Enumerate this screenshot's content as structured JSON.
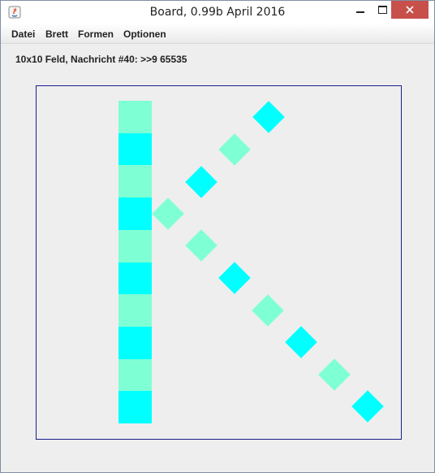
{
  "window": {
    "title": "Board, 0.99b April 2016"
  },
  "menu": {
    "items": [
      "Datei",
      "Brett",
      "Formen",
      "Optionen"
    ]
  },
  "status": {
    "message": "10x10 Feld, Nachricht #40: >>9 65535"
  },
  "colors": {
    "aquamarine": "#7fffd4",
    "cyan": "#00ffff",
    "board_border": "#1b1f8a",
    "background": "#eeeeee"
  },
  "board": {
    "grid_size": "10x10",
    "column_cells": [
      "aquamarine",
      "cyan",
      "aquamarine",
      "cyan",
      "aquamarine",
      "cyan",
      "aquamarine",
      "cyan",
      "aquamarine",
      "cyan"
    ],
    "upper_diagonal": [
      "cyan",
      "aquamarine",
      "cyan",
      "aquamarine"
    ],
    "lower_diagonal": [
      "aquamarine",
      "cyan",
      "aquamarine",
      "cyan",
      "aquamarine",
      "cyan"
    ]
  }
}
